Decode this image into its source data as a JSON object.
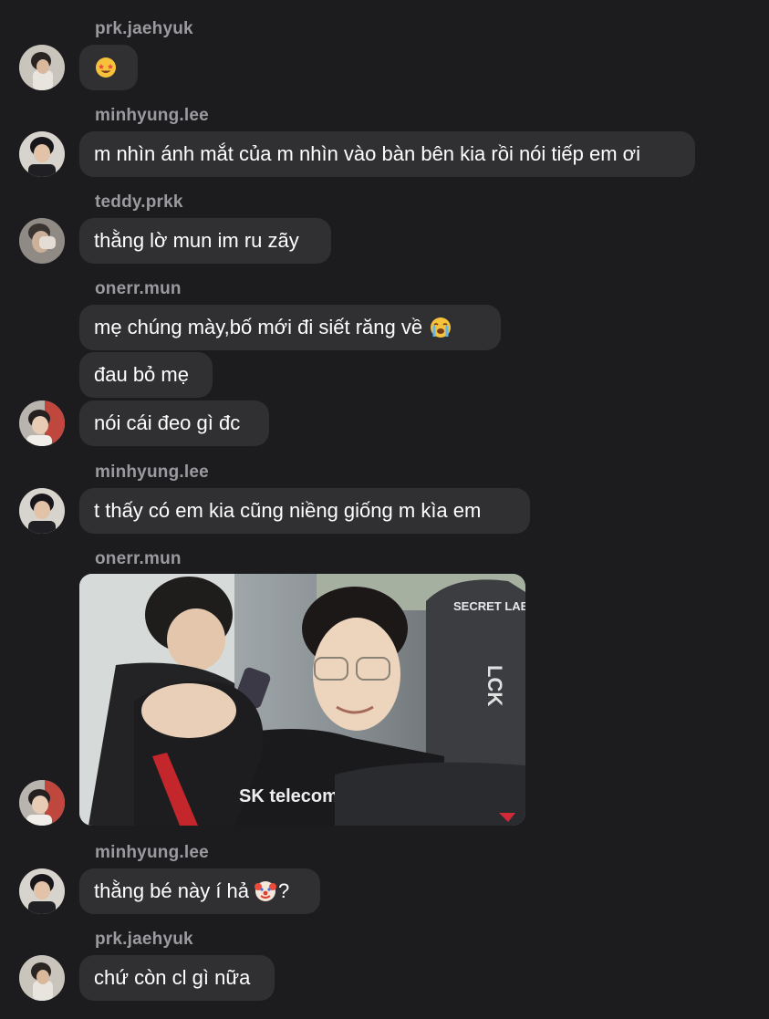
{
  "messages": [
    {
      "sender": "prk.jaehyuk",
      "text": "",
      "emoji": "star-struck-emoji"
    },
    {
      "sender": "minhyung.lee",
      "text": "m nhìn ánh mắt của m nhìn vào bàn bên kia rồi nói tiếp em ơi"
    },
    {
      "sender": "teddy.prkk",
      "text": "thằng lờ mun im ru zãy"
    },
    {
      "sender": "onerr.mun",
      "texts": [
        "mẹ chúng mày,bố mới đi siết răng về",
        "đau bỏ mẹ",
        "nói cái đeo gì đc"
      ],
      "emoji": "loudly-crying-emoji"
    },
    {
      "sender": "minhyung.lee",
      "text": "t thấy có em kia cũng niềng giống m kìa em"
    },
    {
      "sender": "onerr.mun",
      "image": {
        "alt": "photo",
        "logo_text": "SECRET LAB",
        "chair_text": "LCK",
        "shirt_text": "SK telecom"
      }
    },
    {
      "sender": "minhyung.lee",
      "text": "thằng bé này í hả",
      "text_after": "?",
      "emoji": "clown-emoji"
    },
    {
      "sender": "prk.jaehyuk",
      "text": "chứ còn cl gì nữa"
    }
  ],
  "colors": {
    "background": "#1c1c1e",
    "bubble": "#303033",
    "sender_name": "#9a9a9f",
    "text": "#ffffff"
  }
}
